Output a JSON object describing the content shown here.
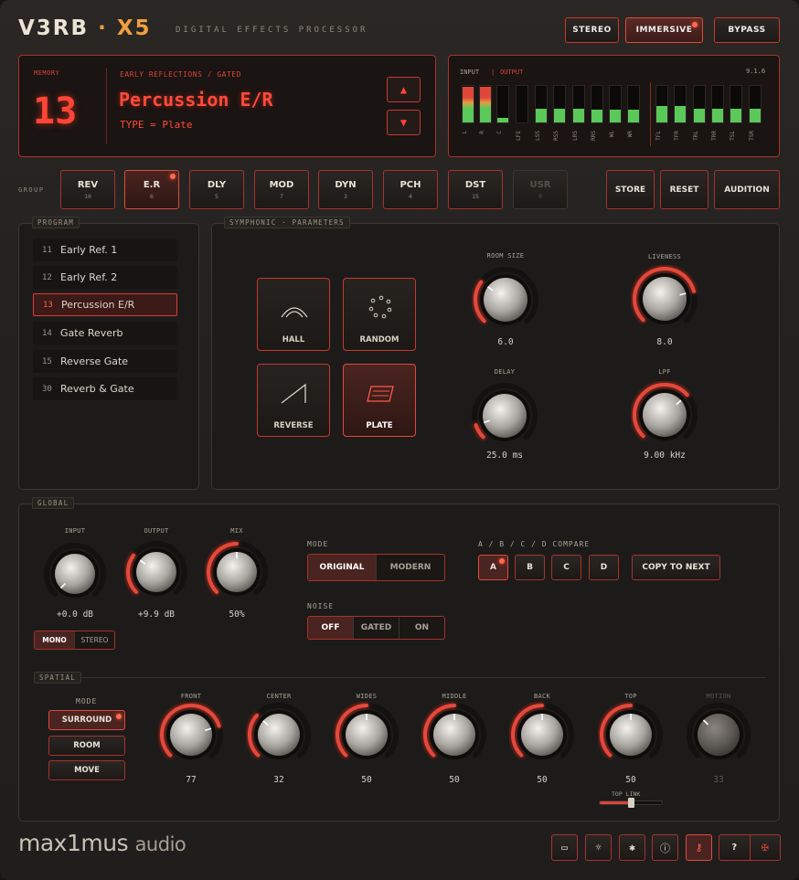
{
  "header": {
    "brand_a": "V3RB",
    "brand_sep": "·",
    "brand_b": "X5",
    "subtitle": "DIGITAL EFFECTS PROCESSOR"
  },
  "top_buttons": [
    {
      "label": "STEREO"
    },
    {
      "label": "IMMERSIVE",
      "active": true
    },
    {
      "label": "BYPASS"
    }
  ],
  "display": {
    "memory_label": "MEMORY",
    "memory_number": "13",
    "category": "EARLY REFLECTIONS / GATED",
    "program_name": "Percussion E/R",
    "type_text": "TYPE = Plate",
    "up_arrow": "▲",
    "down_arrow": "▼"
  },
  "meters": {
    "input_label": "INPUT",
    "sep": "|",
    "output_label": "OUTPUT",
    "version": "9.1.6",
    "channels": [
      {
        "name": "L",
        "level": 0.98,
        "kind": "input"
      },
      {
        "name": "R",
        "level": 0.98,
        "kind": "input"
      },
      {
        "name": "C",
        "level": 0.12,
        "kind": "output"
      },
      {
        "name": "LFE",
        "level": 0.0,
        "kind": "output"
      },
      {
        "name": "LSS",
        "level": 0.38,
        "kind": "output"
      },
      {
        "name": "RSS",
        "level": 0.38,
        "kind": "output"
      },
      {
        "name": "LRS",
        "level": 0.38,
        "kind": "output"
      },
      {
        "name": "RRS",
        "level": 0.36,
        "kind": "output"
      },
      {
        "name": "WL",
        "level": 0.36,
        "kind": "output"
      },
      {
        "name": "WR",
        "level": 0.36,
        "kind": "output"
      },
      {
        "name": "TFL",
        "level": 0.45,
        "kind": "output"
      },
      {
        "name": "TFR",
        "level": 0.45,
        "kind": "output"
      },
      {
        "name": "TRL",
        "level": 0.38,
        "kind": "output"
      },
      {
        "name": "TRR",
        "level": 0.38,
        "kind": "output"
      },
      {
        "name": "TSL",
        "level": 0.38,
        "kind": "output"
      },
      {
        "name": "TSR",
        "level": 0.38,
        "kind": "output"
      }
    ]
  },
  "group": {
    "label": "GROUP",
    "items": [
      {
        "name": "REV",
        "count": "10"
      },
      {
        "name": "E.R",
        "count": "6",
        "active": true
      },
      {
        "name": "DLY",
        "count": "5"
      },
      {
        "name": "MOD",
        "count": "7"
      },
      {
        "name": "DYN",
        "count": "3"
      },
      {
        "name": "PCH",
        "count": "4"
      },
      {
        "name": "DST",
        "count": "15"
      },
      {
        "name": "USR",
        "count": "0",
        "disabled": true
      }
    ],
    "actions": [
      "STORE",
      "RESET",
      "AUDITION"
    ]
  },
  "program": {
    "label": "PROGRAM",
    "items": [
      {
        "num": "11",
        "name": "Early Ref. 1"
      },
      {
        "num": "12",
        "name": "Early Ref. 2"
      },
      {
        "num": "13",
        "name": "Percussion E/R",
        "active": true
      },
      {
        "num": "14",
        "name": "Gate Reverb"
      },
      {
        "num": "15",
        "name": "Reverse Gate"
      },
      {
        "num": "30",
        "name": "Reverb & Gate"
      }
    ]
  },
  "params": {
    "label": "SYMPHONIC · PARAMETERS",
    "types": [
      {
        "name": "HALL",
        "icon": "hall-icon"
      },
      {
        "name": "RANDOM",
        "icon": "random-icon"
      },
      {
        "name": "REVERSE",
        "icon": "reverse-icon"
      },
      {
        "name": "PLATE",
        "icon": "plate-icon",
        "active": true
      }
    ],
    "knobs": [
      {
        "label": "ROOM SIZE",
        "value": "6.0",
        "level": 0.3
      },
      {
        "label": "LIVENESS",
        "value": "8.0",
        "level": 0.78
      },
      {
        "label": "DELAY",
        "value": "25.0 ms",
        "level": 0.1
      },
      {
        "label": "LPF",
        "value": "9.00 kHz",
        "level": 0.68
      }
    ]
  },
  "global": {
    "label": "GLOBAL",
    "knobs": [
      {
        "label": "INPUT",
        "value": "+0.0 dB",
        "level": 0.0
      },
      {
        "label": "OUTPUT",
        "value": "+9.9 dB",
        "level": 0.3
      },
      {
        "label": "MIX",
        "value": "50%",
        "level": 0.5
      }
    ],
    "mono_stereo": [
      {
        "label": "MONO",
        "active": true
      },
      {
        "label": "STEREO"
      }
    ],
    "mode_label": "MODE",
    "mode": [
      {
        "label": "ORIGINAL",
        "active": true
      },
      {
        "label": "MODERN"
      }
    ],
    "noise_label": "NOISE",
    "noise": [
      {
        "label": "OFF",
        "active": true
      },
      {
        "label": "GATED"
      },
      {
        "label": "ON"
      }
    ],
    "compare_label": "A / B / C / D COMPARE",
    "compare": [
      {
        "label": "A",
        "active": true
      },
      {
        "label": "B"
      },
      {
        "label": "C"
      },
      {
        "label": "D"
      }
    ],
    "copy_label": "COPY TO NEXT"
  },
  "spatial": {
    "label": "SPATIAL",
    "mode_label": "MODE",
    "modes": [
      {
        "label": "SURROUND",
        "active": true
      },
      {
        "label": "ROOM"
      },
      {
        "label": "MOVE"
      }
    ],
    "knobs": [
      {
        "label": "FRONT",
        "value": "77",
        "level": 0.77
      },
      {
        "label": "CENTER",
        "value": "32",
        "level": 0.32
      },
      {
        "label": "WIDES",
        "value": "50",
        "level": 0.5
      },
      {
        "label": "MIDDLE",
        "value": "50",
        "level": 0.5
      },
      {
        "label": "BACK",
        "value": "50",
        "level": 0.5
      },
      {
        "label": "TOP",
        "value": "50",
        "level": 0.5
      },
      {
        "label": "MOTION",
        "value": "33",
        "level": 0.33,
        "disabled": true
      }
    ],
    "top_link_label": "TOP LINK",
    "top_link_level": 0.5
  },
  "footer": {
    "logo_a": "max1mus",
    "logo_b": "audio",
    "buttons": [
      {
        "icon": "book-icon",
        "glyph": "▭"
      },
      {
        "icon": "lightbulb-icon",
        "glyph": "☼"
      },
      {
        "icon": "bug-icon",
        "glyph": "✱"
      },
      {
        "icon": "info-icon",
        "glyph": "ⓘ"
      },
      {
        "icon": "key-icon",
        "glyph": "⚷",
        "active": true
      }
    ],
    "help_glyph": "?",
    "flag_glyph": "✠"
  },
  "colors": {
    "accent": "#e04a3d",
    "led": "#ff4536",
    "meter_green": "#5bc85a",
    "meter_red": "#e0453a"
  }
}
